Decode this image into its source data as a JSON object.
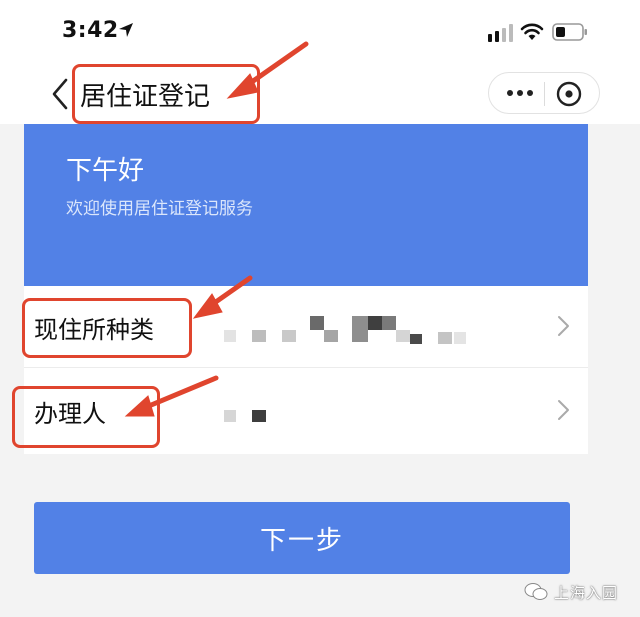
{
  "status_bar": {
    "time": "3:42"
  },
  "nav": {
    "title": "居住证登记"
  },
  "hero": {
    "greeting": "下午好",
    "subtitle": "欢迎使用居住证登记服务"
  },
  "rows": [
    {
      "label": "现住所种类"
    },
    {
      "label": "办理人"
    }
  ],
  "next_button": {
    "label": "下一步"
  },
  "watermark": {
    "text": "上海入园"
  },
  "colors": {
    "primary_blue": "#5281e6",
    "annotation_red": "#e0452e"
  }
}
